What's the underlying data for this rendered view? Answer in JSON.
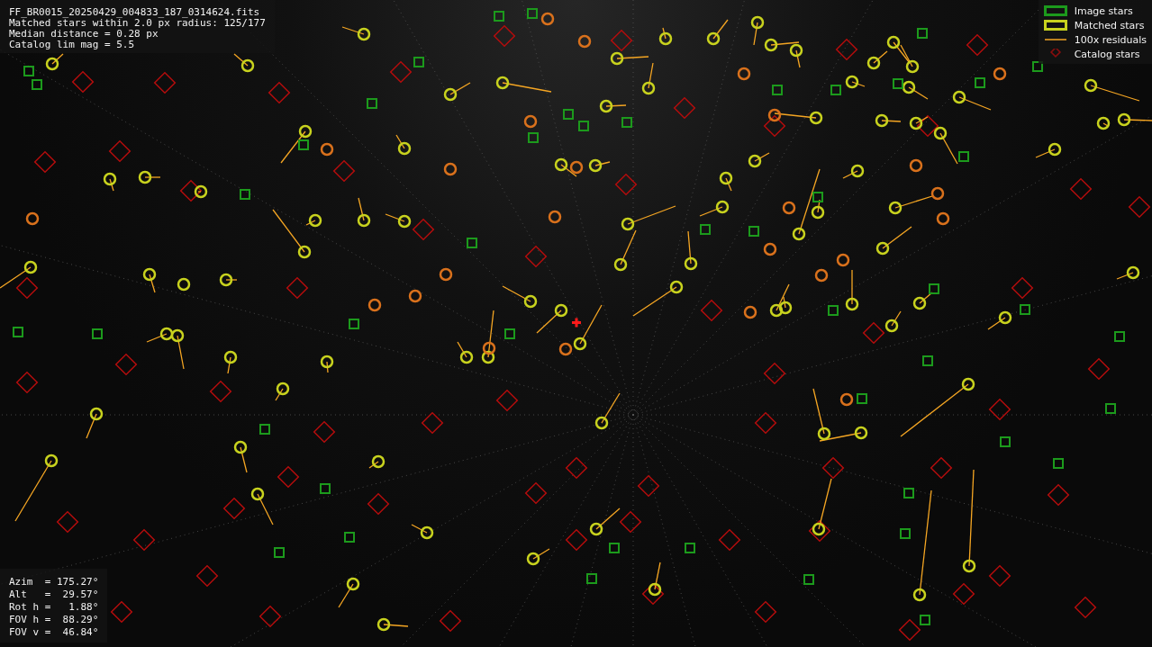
{
  "info_top": [
    "FF_BR0015_20250429_004833_187_0314624.fits",
    "Matched stars within 2.0 px radius: 125/177",
    "Median distance = 0.28 px",
    "Catalog lim mag = 5.5"
  ],
  "legend": [
    {
      "kind": "image",
      "label": "Image stars"
    },
    {
      "kind": "matched",
      "label": "Matched stars"
    },
    {
      "kind": "residual",
      "label": "100x residuals"
    },
    {
      "kind": "catalog",
      "label": "Catalog stars"
    }
  ],
  "info_bottom": [
    "Azim  = 175.27°",
    "Alt   =  29.57°",
    "Rot h =   1.88°",
    "FOV h =  88.29°",
    "FOV v =  46.84°"
  ]
}
